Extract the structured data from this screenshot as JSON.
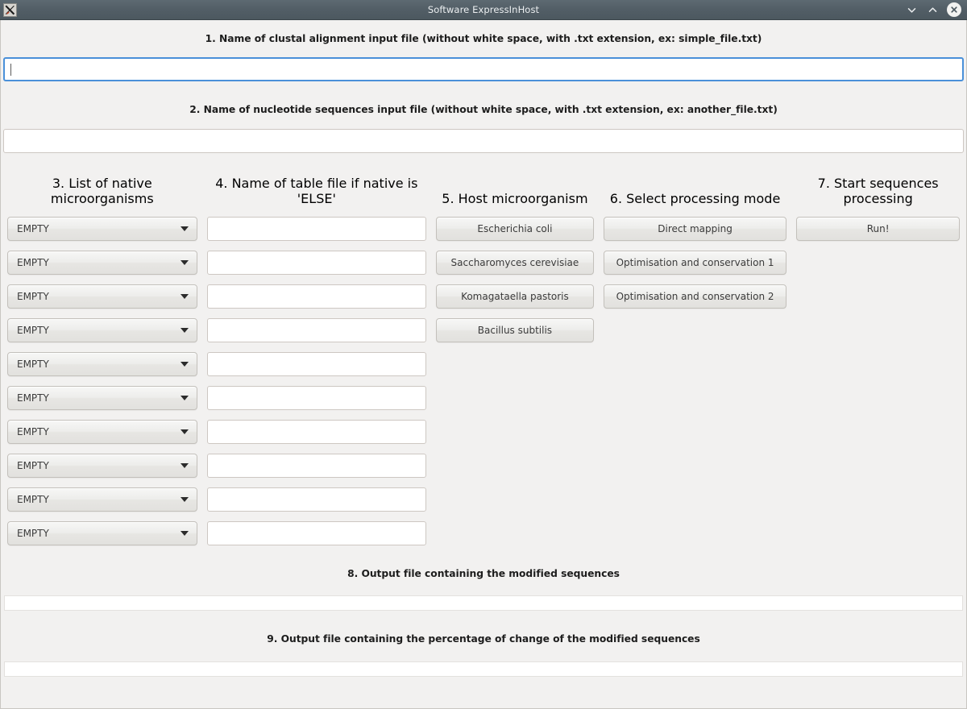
{
  "window": {
    "title": "Software ExpressInHost",
    "icon": "x11-app-icon",
    "controls": [
      {
        "name": "minimize-button",
        "glyph": "∨"
      },
      {
        "name": "maximize-button",
        "glyph": "∧"
      },
      {
        "name": "close-button",
        "glyph": "✕"
      }
    ]
  },
  "sections": {
    "clustal_label": "1. Name of clustal alignment input file (without white space, with .txt extension, ex: simple_file.txt)",
    "clustal_value": "",
    "clustal_placeholder": "",
    "nucleotide_label": "2. Name of nucleotide sequences input file (without white space, with .txt extension, ex: another_file.txt)",
    "nucleotide_value": "",
    "nucleotide_placeholder": "",
    "output_sequences_label": "8. Output file containing the modified sequences",
    "output_sequences_value": "",
    "output_percentage_label": "9. Output file containing the percentage of change of the modified sequences",
    "output_percentage_value": ""
  },
  "columns": {
    "native_microorganisms": {
      "header": "3. List of native microorganisms",
      "dropdowns": [
        {
          "value": "EMPTY"
        },
        {
          "value": "EMPTY"
        },
        {
          "value": "EMPTY"
        },
        {
          "value": "EMPTY"
        },
        {
          "value": "EMPTY"
        },
        {
          "value": "EMPTY"
        },
        {
          "value": "EMPTY"
        },
        {
          "value": "EMPTY"
        },
        {
          "value": "EMPTY"
        },
        {
          "value": "EMPTY"
        }
      ]
    },
    "table_files": {
      "header": "4. Name of table file if native is 'ELSE'",
      "fields": [
        {
          "value": ""
        },
        {
          "value": ""
        },
        {
          "value": ""
        },
        {
          "value": ""
        },
        {
          "value": ""
        },
        {
          "value": ""
        },
        {
          "value": ""
        },
        {
          "value": ""
        },
        {
          "value": ""
        },
        {
          "value": ""
        }
      ]
    },
    "host_microorganism": {
      "header": "5. Host microorganism",
      "buttons": [
        {
          "label": "Escherichia coli"
        },
        {
          "label": "Saccharomyces cerevisiae"
        },
        {
          "label": "Komagataella pastoris"
        },
        {
          "label": "Bacillus subtilis"
        }
      ]
    },
    "processing_mode": {
      "header": "6. Select processing mode",
      "buttons": [
        {
          "label": "Direct mapping"
        },
        {
          "label": "Optimisation and conservation 1"
        },
        {
          "label": "Optimisation and conservation 2"
        }
      ]
    },
    "start_processing": {
      "header": "7. Start sequences processing",
      "buttons": [
        {
          "label": "Run!"
        }
      ]
    }
  },
  "colors": {
    "titlebar": "#525e66",
    "titlebar_text": "#eceff1",
    "window_bg": "#f2f1f0",
    "focus_ring": "#4a90d9",
    "entry_bg": "#ffffff",
    "button_bg": "#ededeb",
    "text": "#1d1d1d"
  }
}
